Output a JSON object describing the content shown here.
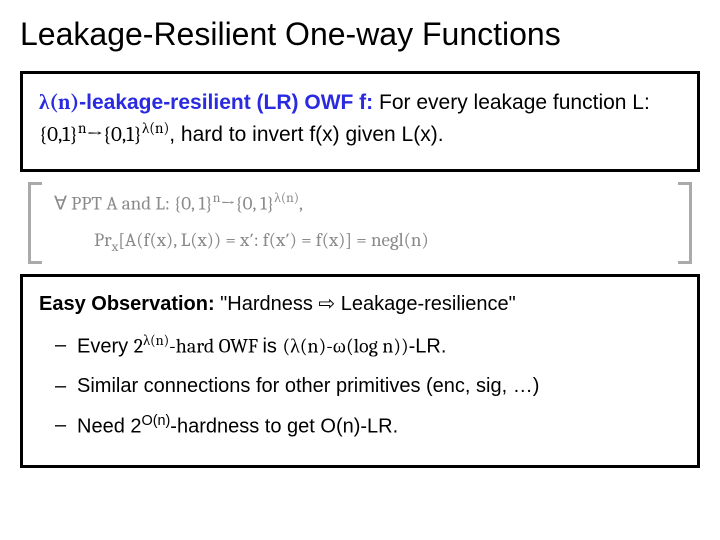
{
  "title": "Leakage-Resilient One-way Functions",
  "def": {
    "prefix_lambda": "λ(n)",
    "prefix_rest": "-leakage-resilient (LR) OWF f:",
    "body_a": " For every leakage function L: ",
    "dom": "{0,1}",
    "n": "n",
    "arrow": "→",
    "lam": "λ(n)",
    "body_b": ", hard to invert f(x) given L(x)."
  },
  "math": {
    "line1_a": "∀ PPT A and L: {0, 1}",
    "line1_b": "→{0, 1}",
    "line1_c": ",",
    "line2_a": "Pr",
    "line2_sub": "x",
    "line2_b": "[A(f(x), L(x)) = x′: f(x′) = f(x)] = negl(n)"
  },
  "obs": {
    "head_bold": "Easy Observation:",
    "head_rest": " \"Hardness ⇨ Leakage-resilience\"",
    "b1_a": "Every ",
    "b1_exp": "2",
    "b1_expsup": "λ(n)",
    "b1_b": "-hard OWF ",
    "b1_is": "is ",
    "b1_c": "(λ(n)-ω(log n))",
    "b1_d": "-LR.",
    "b2": "Similar connections for other primitives (enc, sig, …)",
    "b3_a": "Need 2",
    "b3_sup": "O(n)",
    "b3_b": "-hardness to get O(n)-LR."
  }
}
